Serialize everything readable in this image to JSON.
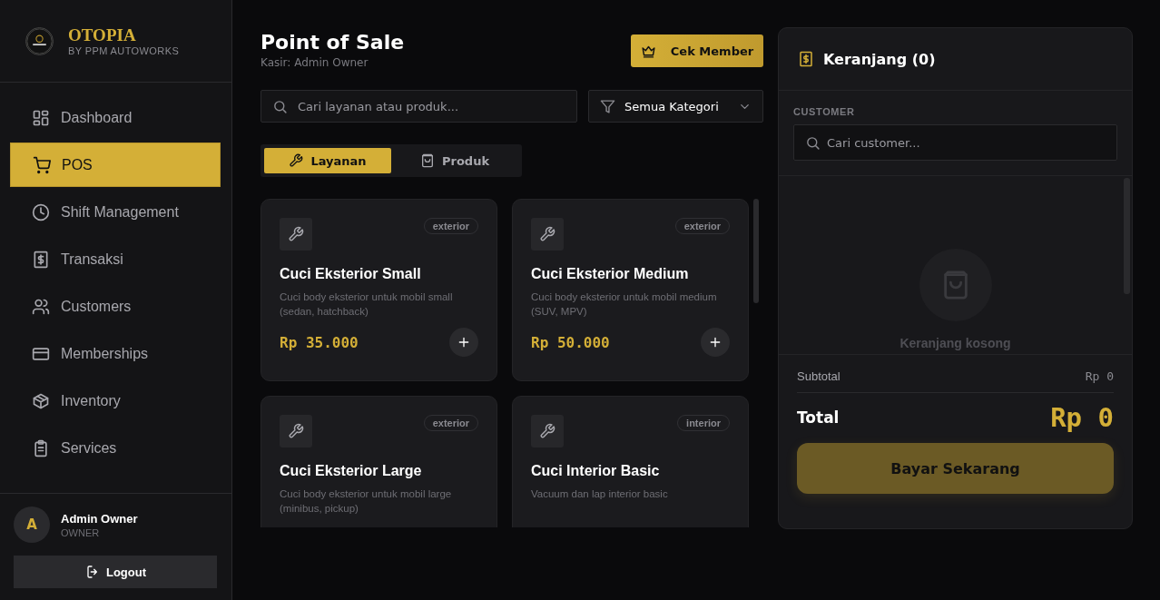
{
  "brand": {
    "name": "OTOPIA",
    "tagline": "BY PPM AUTOWORKS"
  },
  "sidebar": {
    "items": [
      {
        "label": "Dashboard",
        "selected": false
      },
      {
        "label": "POS",
        "selected": true
      },
      {
        "label": "Shift Management",
        "selected": false
      },
      {
        "label": "Transaksi",
        "selected": false
      },
      {
        "label": "Customers",
        "selected": false
      },
      {
        "label": "Memberships",
        "selected": false
      },
      {
        "label": "Inventory",
        "selected": false
      },
      {
        "label": "Services",
        "selected": false
      }
    ]
  },
  "user": {
    "initial": "A",
    "name": "Admin Owner",
    "role": "OWNER",
    "logout": "Logout"
  },
  "header": {
    "title": "Point of Sale",
    "subtitle": "Kasir: Admin Owner",
    "member_button": "Cek Member"
  },
  "search": {
    "placeholder": "Cari layanan atau produk..."
  },
  "category_filter": {
    "value": "Semua Kategori"
  },
  "tabs": [
    {
      "label": "Layanan",
      "selected": true
    },
    {
      "label": "Produk",
      "selected": false
    }
  ],
  "products": [
    {
      "name": "Cuci Eksterior Small",
      "tag": "exterior",
      "description": "Cuci body eksterior untuk mobil small (sedan, hatchback)",
      "price": "Rp 35.000"
    },
    {
      "name": "Cuci Eksterior Medium",
      "tag": "exterior",
      "description": "Cuci body eksterior untuk mobil medium (SUV, MPV)",
      "price": "Rp 50.000"
    },
    {
      "name": "Cuci Eksterior Large",
      "tag": "exterior",
      "description": "Cuci body eksterior untuk mobil large (minibus, pickup)"
    },
    {
      "name": "Cuci Interior Basic",
      "tag": "interior",
      "description": "Vacuum dan lap interior basic"
    }
  ],
  "cart": {
    "title": "Keranjang (0)",
    "customer_label": "CUSTOMER",
    "customer_placeholder": "Cari customer...",
    "empty_text": "Keranjang kosong",
    "subtotal_label": "Subtotal",
    "subtotal": "Rp 0",
    "total_label": "Total",
    "total": "Rp 0",
    "pay_button": "Bayar Sekarang"
  }
}
